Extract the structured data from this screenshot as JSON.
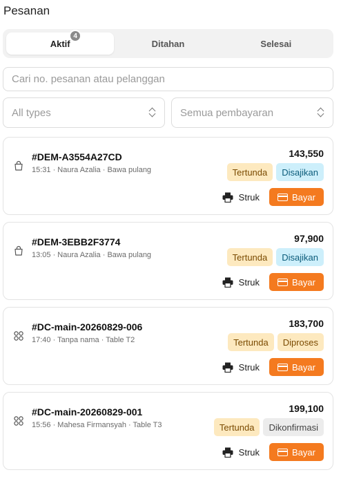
{
  "page": {
    "title": "Pesanan"
  },
  "tabs": [
    {
      "label": "Aktif",
      "badge": "4",
      "active": true
    },
    {
      "label": "Ditahan"
    },
    {
      "label": "Selesai"
    }
  ],
  "search": {
    "placeholder": "Cari no. pesanan atau pelanggan"
  },
  "filters": {
    "type": "All types",
    "payment": "Semua pembayaran"
  },
  "orders": [
    {
      "number": "#DEM-A3554A27CD",
      "meta": "15:31 · Naura Azalia · Bawa pulang",
      "total": "143,550",
      "type_icon": "shopping-bag-icon",
      "payment_status": "Tertunda",
      "order_status": "Disajikan",
      "receipt_label": "Struk",
      "pay_label": "Bayar"
    },
    {
      "number": "#DEM-3EBB2F3774",
      "meta": "13:05 · Naura Azalia · Bawa pulang",
      "total": "97,900",
      "type_icon": "shopping-bag-icon",
      "payment_status": "Tertunda",
      "order_status": "Disajikan",
      "receipt_label": "Struk",
      "pay_label": "Bayar"
    },
    {
      "number": "#DC-main-20260829-006",
      "meta": "17:40 · Tanpa nama · Table T2",
      "total": "183,700",
      "type_icon": "table-icon",
      "payment_status": "Tertunda",
      "order_status": "Diproses",
      "receipt_label": "Struk",
      "pay_label": "Bayar"
    },
    {
      "number": "#DC-main-20260829-001",
      "meta": "15:56 · Mahesa Firmansyah · Table T3",
      "total": "199,100",
      "type_icon": "table-icon",
      "payment_status": "Tertunda",
      "order_status": "Dikonfirmasi",
      "receipt_label": "Struk",
      "pay_label": "Bayar"
    }
  ],
  "colors": {
    "accent": "#f47a1f",
    "pending_bg": "#fde9bf",
    "served_bg": "#cdeffb",
    "confirmed_bg": "#ececec"
  }
}
